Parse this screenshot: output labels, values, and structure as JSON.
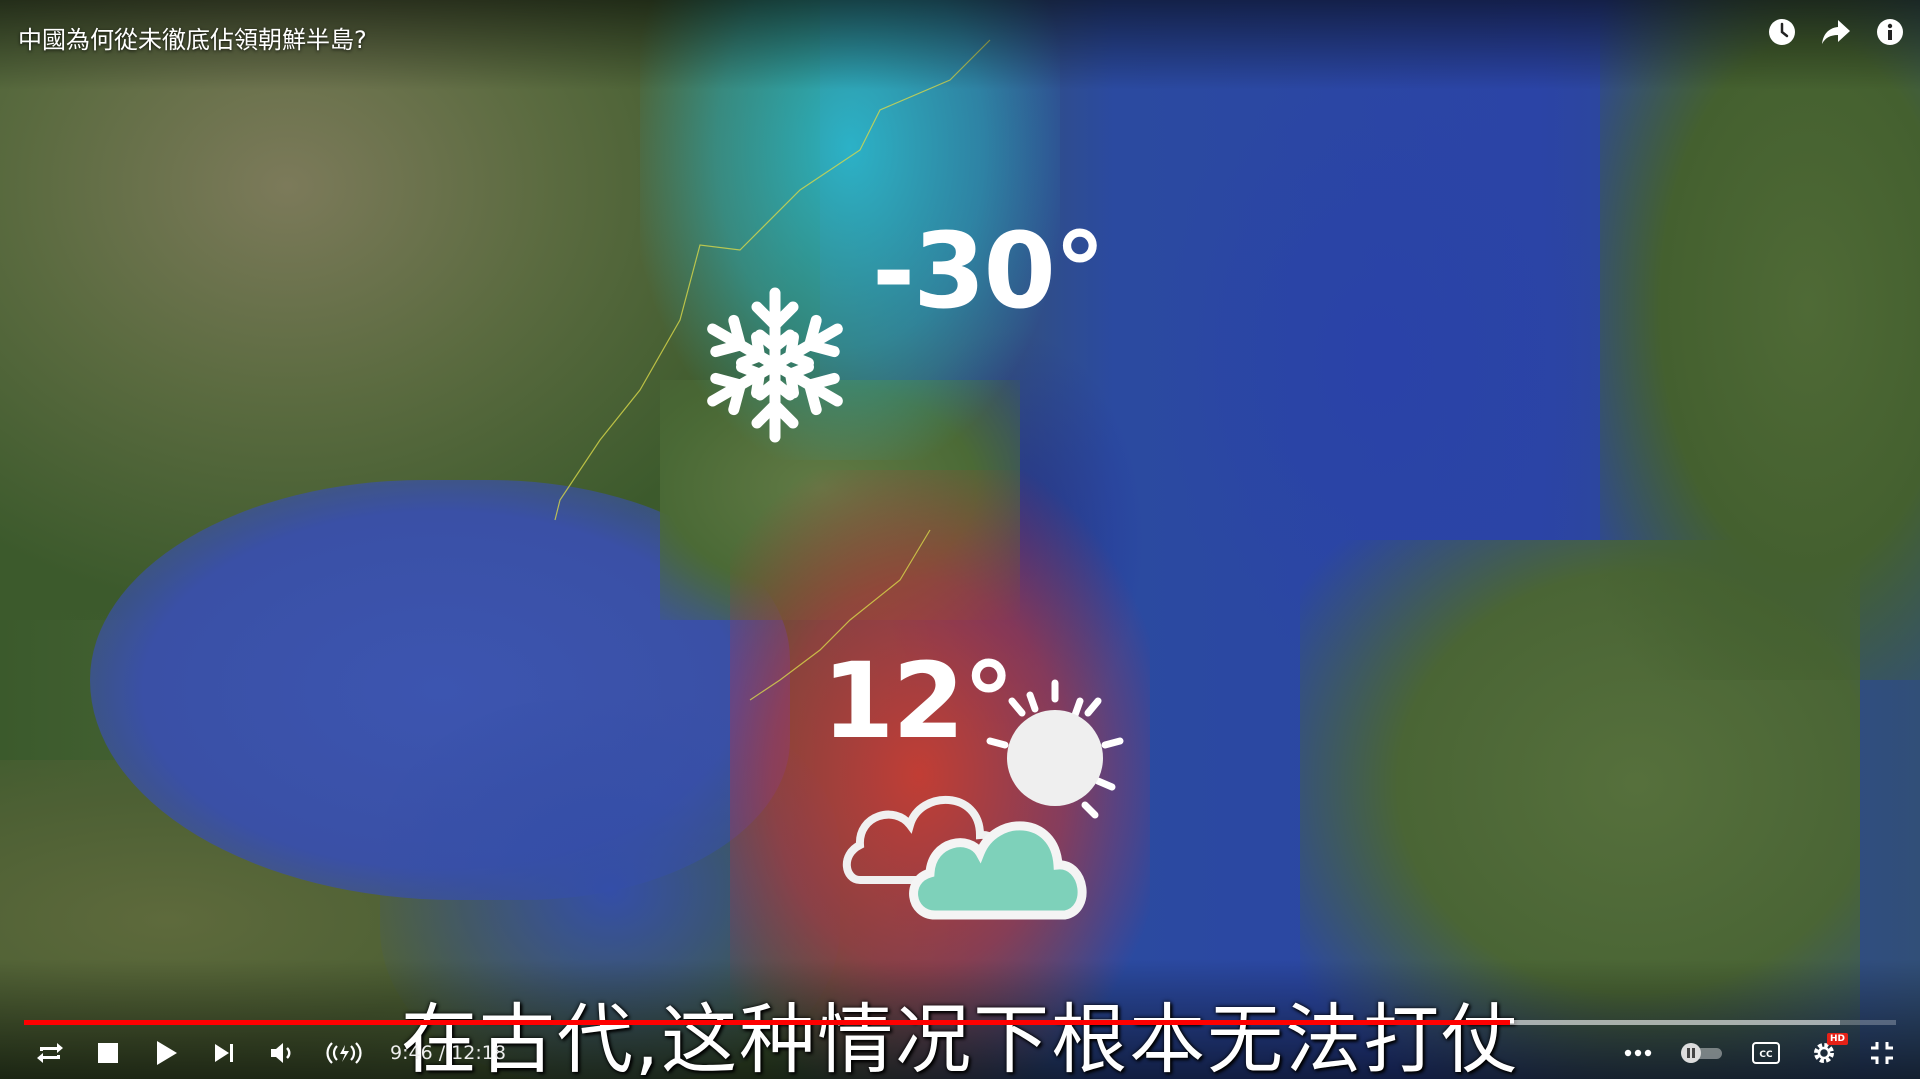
{
  "video": {
    "title": "中國為何從未徹底佔領朝鮮半島?",
    "subtitle": "在古代,这种情况下根本无法打仗",
    "overlay": {
      "cold_temp": "-30°",
      "warm_temp": "12°",
      "cold_icon": "snowflake-icon",
      "warm_icon": "sun-cloud-icon"
    }
  },
  "top_bar": {
    "icons": [
      "watch-later-icon",
      "share-icon",
      "info-icon"
    ]
  },
  "player": {
    "time_display": "9:46 / 12:18",
    "progress": {
      "played_fraction": 0.794,
      "buffered_fraction": 0.97
    },
    "colors": {
      "played": "#ff0000",
      "hd_badge": "#e62117"
    },
    "hd_label": "HD",
    "left_controls": [
      "loop-icon",
      "stop-icon",
      "play-icon",
      "next-icon",
      "volume-icon",
      "live-audio-icon"
    ],
    "right_controls": [
      "more-icon",
      "autoplay-toggle-icon",
      "captions-icon",
      "settings-icon",
      "exit-fullscreen-icon"
    ]
  }
}
